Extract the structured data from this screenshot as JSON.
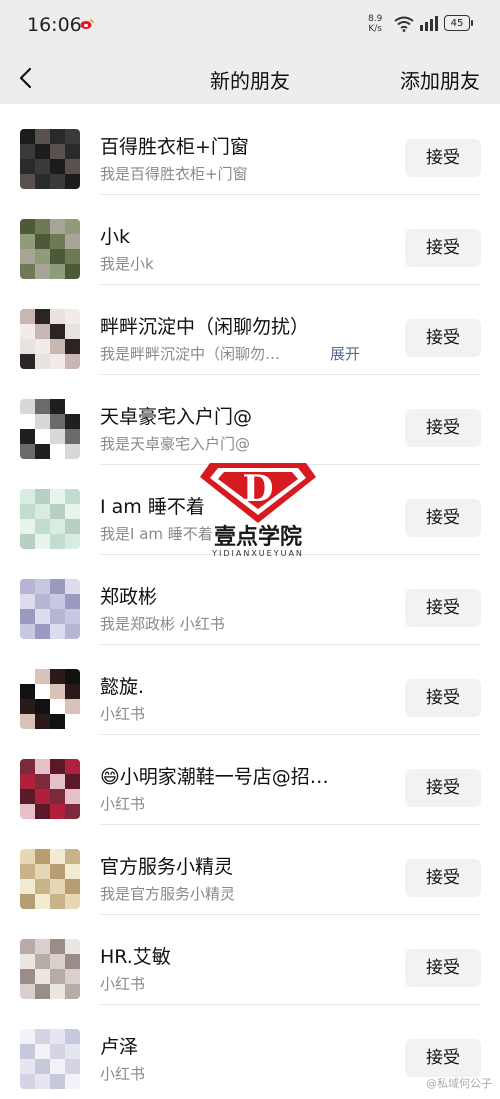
{
  "status_bar": {
    "time": "16:06",
    "speed_value": "8.9",
    "speed_unit": "K/s",
    "battery": "45"
  },
  "nav": {
    "title": "新的朋友",
    "action": "添加朋友"
  },
  "accept_label": "接受",
  "expand_label": "展开",
  "requests": [
    {
      "name": "百得胜衣柜+门窗",
      "message": "我是百得胜衣柜+门窗",
      "avatar_colors": [
        "#1c1c1c",
        "#3a3a3a",
        "#2a2a2a",
        "#5a5050"
      ]
    },
    {
      "name": "小k",
      "message": "我是小k",
      "avatar_colors": [
        "#6e7a55",
        "#4c5a3a",
        "#8e9c7a",
        "#a9a49a"
      ]
    },
    {
      "name": "畔畔沉淀中（闲聊勿扰）",
      "message": "我是畔畔沉淀中（闲聊勿…",
      "avatar_colors": [
        "#e9e3e0",
        "#2b2424",
        "#c9b6b0",
        "#f1ecea"
      ]
    },
    {
      "name": "天卓豪宅入户门@",
      "message": "我是天卓豪宅入户门@",
      "avatar_colors": [
        "#ffffff",
        "#1f1f1f",
        "#6a6a6a",
        "#d8d8d8"
      ]
    },
    {
      "name": "I am 睡不着",
      "message": "我是I am 睡不着",
      "avatar_colors": [
        "#d9ece2",
        "#c2dccd",
        "#e9f3ee",
        "#b8cfc3"
      ]
    },
    {
      "name": "郑政彬",
      "message": "我是郑政彬 小红书",
      "avatar_colors": [
        "#c8c8e0",
        "#b6b6d4",
        "#dcdcee",
        "#9a9ac0"
      ]
    },
    {
      "name": "懿旋.",
      "message": "小红书",
      "avatar_colors": [
        "#2a1a1a",
        "#d9c2b8",
        "#ffffff",
        "#111111"
      ]
    },
    {
      "name": "😄小明家潮鞋一号店@招…",
      "message": "小红书",
      "avatar_colors": [
        "#b0203a",
        "#5a1a2a",
        "#e6c0c8",
        "#7a2a3a"
      ]
    },
    {
      "name": "官方服务小精灵",
      "message": "我是官方服务小精灵",
      "avatar_colors": [
        "#e6d8b4",
        "#c9b48a",
        "#f3ead2",
        "#b79e72"
      ]
    },
    {
      "name": "HR.艾敏",
      "message": "小红书",
      "avatar_colors": [
        "#d8d0cc",
        "#b8aaa4",
        "#ece6e2",
        "#9a8c86"
      ]
    },
    {
      "name": "卢泽",
      "message": "小红书",
      "avatar_colors": [
        "#e6e6f0",
        "#d4d4e6",
        "#f2f2f8",
        "#c8c8dc"
      ]
    }
  ],
  "watermark": {
    "text": "壹点学院",
    "subtext": "YIDIANXUEYUAN",
    "logo_letter": "D"
  },
  "corner_mark": "@私域何公子"
}
